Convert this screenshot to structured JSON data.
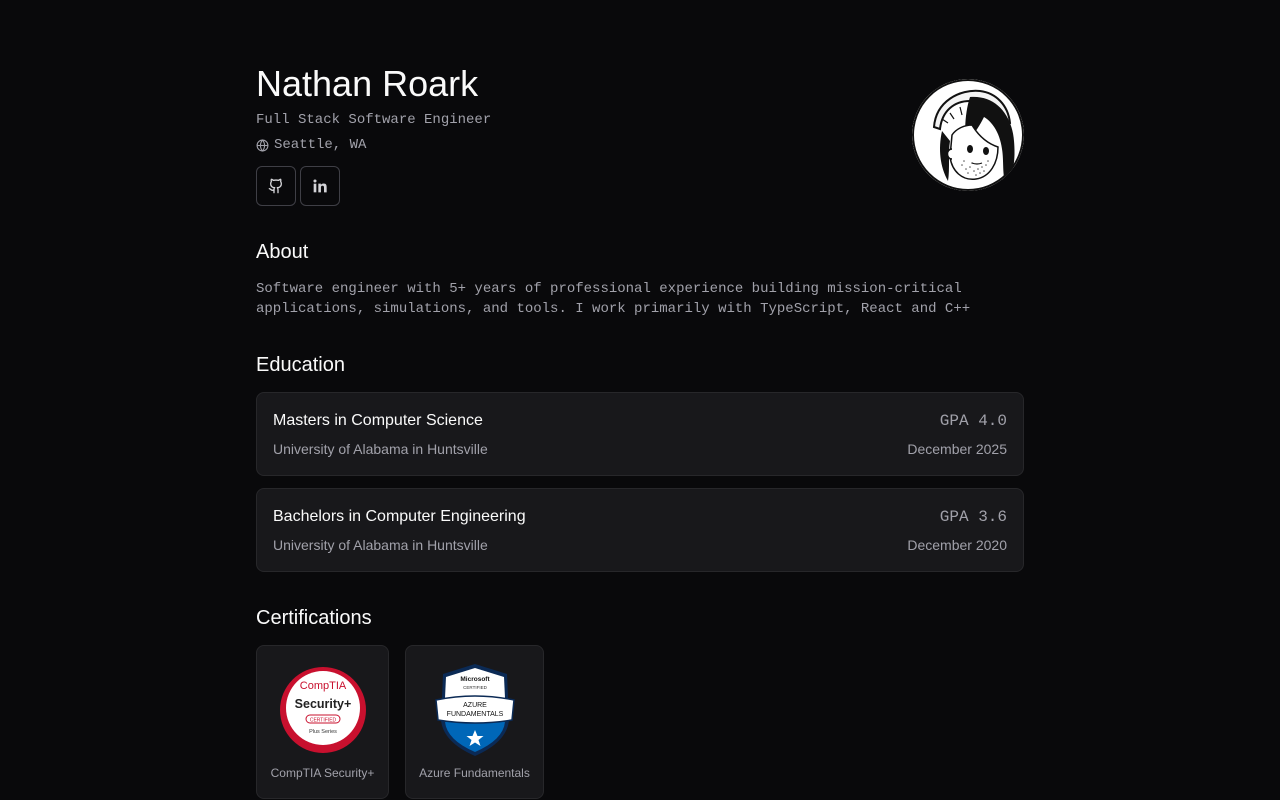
{
  "profile": {
    "name": "Nathan Roark",
    "title": "Full Stack Software Engineer",
    "location": "Seattle, WA",
    "socials": [
      {
        "icon": "github-icon"
      },
      {
        "icon": "linkedin-icon"
      }
    ]
  },
  "about": {
    "heading": "About",
    "text": "Software engineer with 5+ years of professional experience building mission-critical applications, simulations, and tools. I work primarily with TypeScript, React and C++"
  },
  "education": {
    "heading": "Education",
    "items": [
      {
        "degree": "Masters in Computer Science",
        "school": "University of Alabama in Huntsville",
        "gpa": "GPA 4.0",
        "date": "December 2025"
      },
      {
        "degree": "Bachelors in Computer Engineering",
        "school": "University of Alabama in Huntsville",
        "gpa": "GPA 3.6",
        "date": "December 2020"
      }
    ]
  },
  "certifications": {
    "heading": "Certifications",
    "items": [
      {
        "label": "CompTIA Security+",
        "badge": {
          "brand": "CompTIA",
          "name": "Security+",
          "tag": "CERTIFIED",
          "series": "Plus Series"
        }
      },
      {
        "label": "Azure Fundamentals",
        "badge": {
          "brand": "Microsoft",
          "tag": "CERTIFIED",
          "line1": "AZURE",
          "line2": "FUNDAMENTALS"
        }
      }
    ]
  },
  "colors": {
    "background": "#09090b",
    "card": "#18181b",
    "border": "#27272a",
    "muted_text": "#a1a1aa",
    "comptia_red": "#c8102e",
    "azure_blue": "#0067b8"
  }
}
